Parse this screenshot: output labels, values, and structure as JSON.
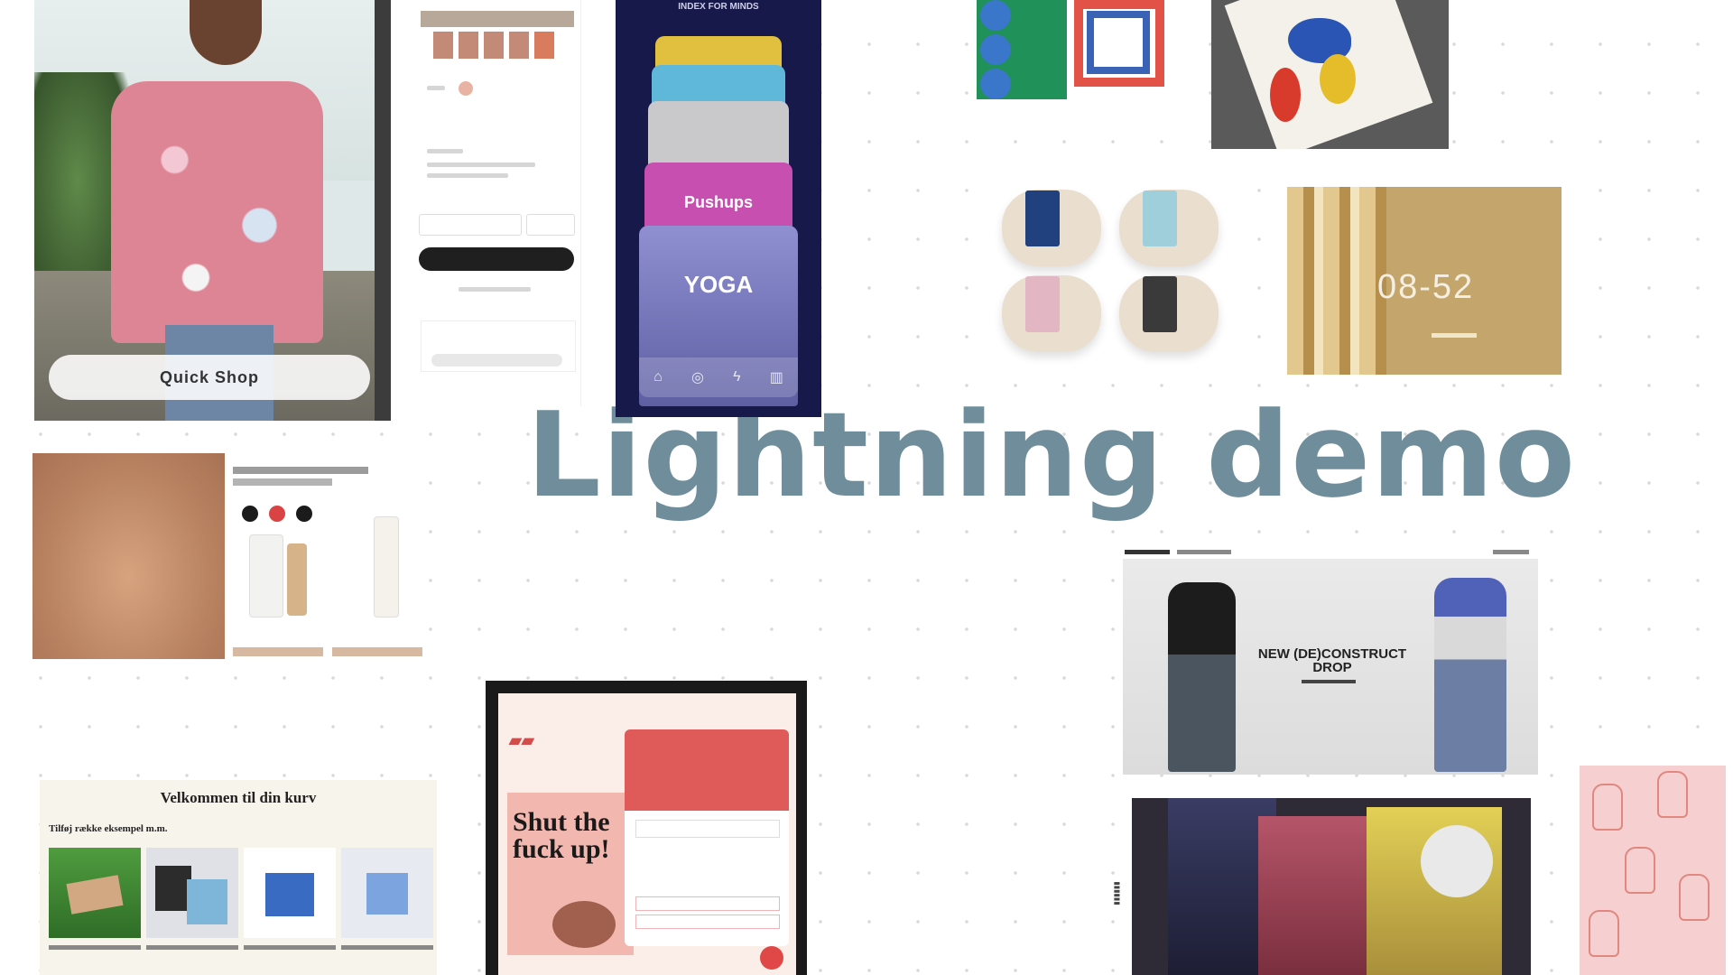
{
  "title": "Lightning demo",
  "quick_shop_label": "Quick Shop",
  "yoga": {
    "header": "INDEX FOR MINDS",
    "pushups_label": "Pushups",
    "yoga_label": "YOGA",
    "nav_icons": [
      "home-icon",
      "compass-icon",
      "flame-icon",
      "stats-icon"
    ]
  },
  "cart": {
    "heading": "Velkommen til din kurv",
    "subheading": "Tilføj række eksempel m.m."
  },
  "poster": {
    "headline": "Shut the fuck up!"
  },
  "decon": {
    "headline": "NEW (DE)CONSTRUCT DROP"
  },
  "gold": {
    "number": "08-52"
  },
  "colors": {
    "title": "#6f8d9b",
    "yoga_bg": "#16194a",
    "poster_red": "#de5b59"
  }
}
